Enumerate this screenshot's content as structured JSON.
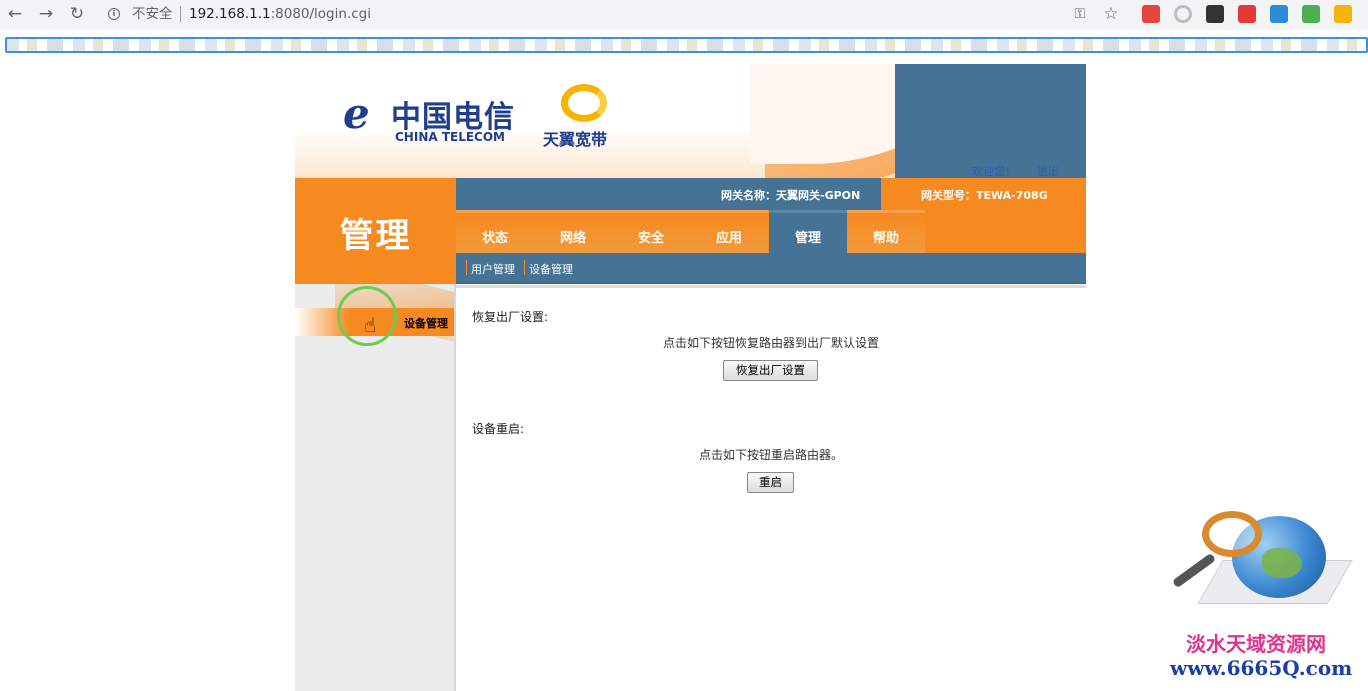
{
  "browser": {
    "back_glyph": "←",
    "forward_glyph": "→",
    "reload_glyph": "↻",
    "insecure_label": "不安全",
    "url_host": "192.168.1.1",
    "url_rest": ":8080/login.cgi",
    "star_glyph": "☆",
    "key_glyph": "⚿",
    "extensions": [
      "#e6453c",
      "#bdbdbd",
      "#333333",
      "#e53935",
      "#2a8bd8",
      "#4caf50",
      "#f5b400"
    ]
  },
  "header": {
    "ct_mark": "ℯ",
    "ct_cn": "中国电信",
    "ct_en": "CHINA TELECOM",
    "ty_text": "天翼宽带",
    "welcome": "欢迎您！",
    "logout": "退出"
  },
  "section_title": "管理",
  "gateway": {
    "name": "网关名称：天翼网关-GPON",
    "model": "网关型号：TEWA-708G"
  },
  "tabs": [
    {
      "label": "状态",
      "active": false
    },
    {
      "label": "网络",
      "active": false
    },
    {
      "label": "安全",
      "active": false
    },
    {
      "label": "应用",
      "active": false
    },
    {
      "label": "管理",
      "active": true
    },
    {
      "label": "帮助",
      "active": false
    }
  ],
  "subtabs": [
    "用户管理",
    "设备管理"
  ],
  "sidebar": {
    "items": [
      {
        "label": "设备管理",
        "active": true
      }
    ]
  },
  "content": {
    "restore_label": "恢复出厂设置:",
    "restore_desc": "点击如下按钮恢复路由器到出厂默认设置",
    "restore_button": "恢复出厂设置",
    "reboot_label": "设备重启:",
    "reboot_desc": "点击如下按钮重启路由器。",
    "reboot_button": "重启"
  },
  "watermark": {
    "line1": "淡水天域资源网",
    "line2": "www.6665Q.com"
  },
  "colors": {
    "orange": "#f6891f",
    "blue": "#457396"
  }
}
